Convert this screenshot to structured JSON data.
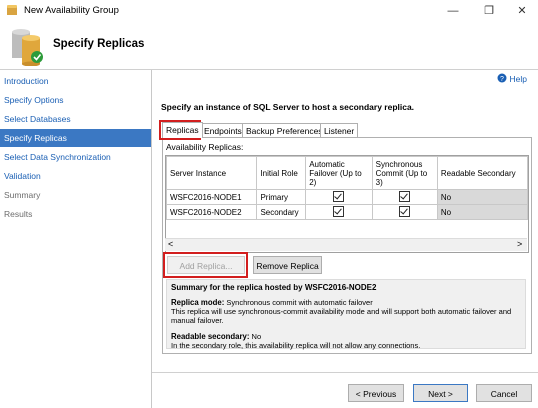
{
  "window": {
    "title": "New Availability Group",
    "minimize_glyph": "—",
    "maximize_glyph": "❐",
    "close_glyph": "✕"
  },
  "header": {
    "title": "Specify Replicas"
  },
  "sidebar": {
    "items": [
      {
        "label": "Introduction",
        "state": "link"
      },
      {
        "label": "Specify Options",
        "state": "link"
      },
      {
        "label": "Select Databases",
        "state": "link"
      },
      {
        "label": "Specify Replicas",
        "state": "active"
      },
      {
        "label": "Select Data Synchronization",
        "state": "link"
      },
      {
        "label": "Validation",
        "state": "link"
      },
      {
        "label": "Summary",
        "state": "disabled"
      },
      {
        "label": "Results",
        "state": "disabled"
      }
    ]
  },
  "help": {
    "label": "Help",
    "icon": "help-icon"
  },
  "instruction": "Specify an instance of SQL Server to host a secondary replica.",
  "tabs": [
    {
      "label": "Replicas",
      "selected": true
    },
    {
      "label": "Endpoints"
    },
    {
      "label": "Backup Preferences"
    },
    {
      "label": "Listener"
    }
  ],
  "grid": {
    "label": "Availability Replicas:",
    "columns": [
      "Server Instance",
      "Initial Role",
      "Automatic Failover (Up to 2)",
      "Synchronous Commit (Up to 3)",
      "Readable Secondary"
    ],
    "rows": [
      {
        "server": "WSFC2016-NODE1",
        "role": "Primary",
        "auto_failover": true,
        "sync_commit": true,
        "readable": "No"
      },
      {
        "server": "WSFC2016-NODE2",
        "role": "Secondary",
        "auto_failover": true,
        "sync_commit": true,
        "readable": "No"
      }
    ]
  },
  "scrollbar": {
    "left_glyph": "<",
    "right_glyph": ">"
  },
  "buttons": {
    "add_replica": "Add Replica...",
    "remove_replica": "Remove Replica",
    "previous": "< Previous",
    "next": "Next >",
    "cancel": "Cancel"
  },
  "summary": {
    "heading": "Summary for the replica hosted by WSFC2016-NODE2",
    "replica_mode_label": "Replica mode:",
    "replica_mode_value": "Synchronous commit with automatic failover",
    "replica_mode_desc": "This replica will use synchronous-commit availability mode and will support both automatic failover and manual failover.",
    "readable_label": "Readable secondary:",
    "readable_value": "No",
    "readable_desc": "In the secondary role, this availability replica will not allow any connections."
  },
  "colors": {
    "accent": "#3b78c3",
    "link": "#1a5fb4",
    "highlight_box": "#d21e1e"
  }
}
